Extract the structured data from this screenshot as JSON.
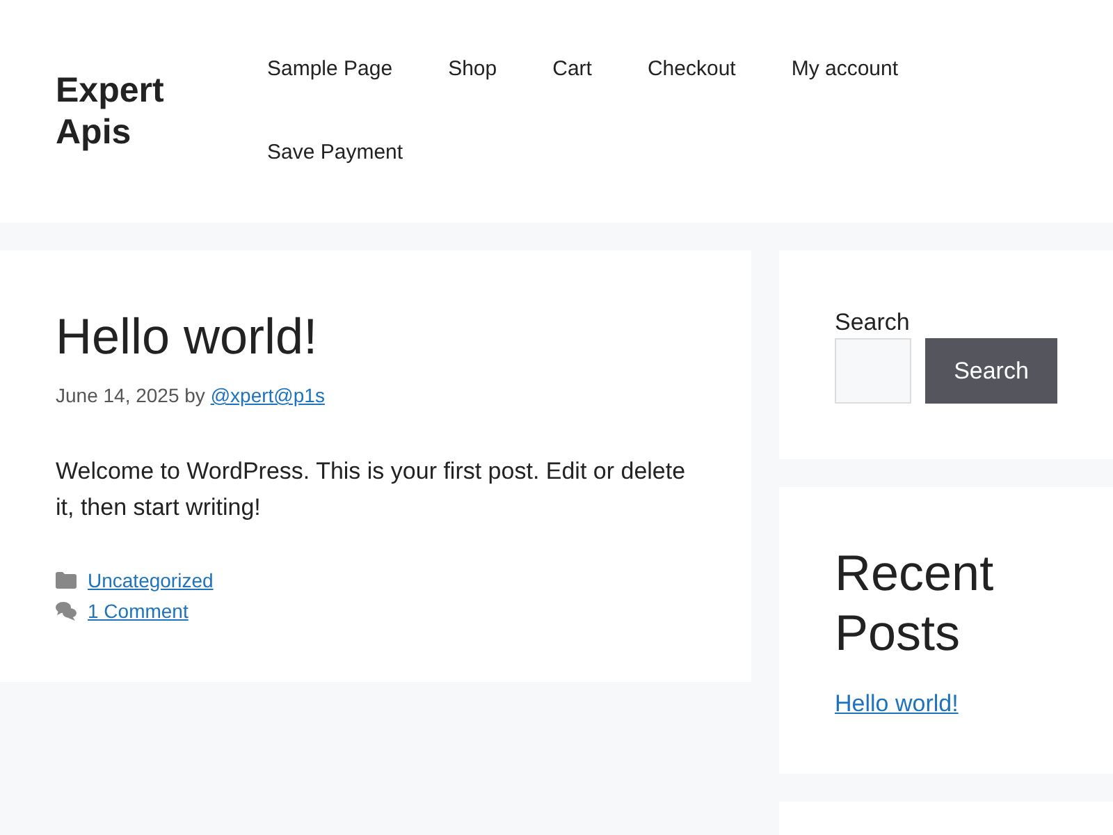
{
  "site": {
    "title": "Expert Apis"
  },
  "nav": [
    {
      "label": "Sample Page"
    },
    {
      "label": "Shop"
    },
    {
      "label": "Cart"
    },
    {
      "label": "Checkout"
    },
    {
      "label": "My account"
    },
    {
      "label": "Save Payment"
    }
  ],
  "post": {
    "title": "Hello world!",
    "date": "June 14, 2025",
    "by": "by",
    "author": "@xpert@p1s",
    "body": "Welcome to WordPress. This is your first post. Edit or delete it, then start writing!",
    "category": "Uncategorized",
    "comments": "1 Comment"
  },
  "sidebar": [
    {
      "kind": "search",
      "label": "Search",
      "button": "Search"
    },
    {
      "kind": "recent_posts",
      "title": "Recent Posts",
      "links": [
        "Hello world!"
      ]
    },
    {
      "kind": "empty"
    }
  ]
}
